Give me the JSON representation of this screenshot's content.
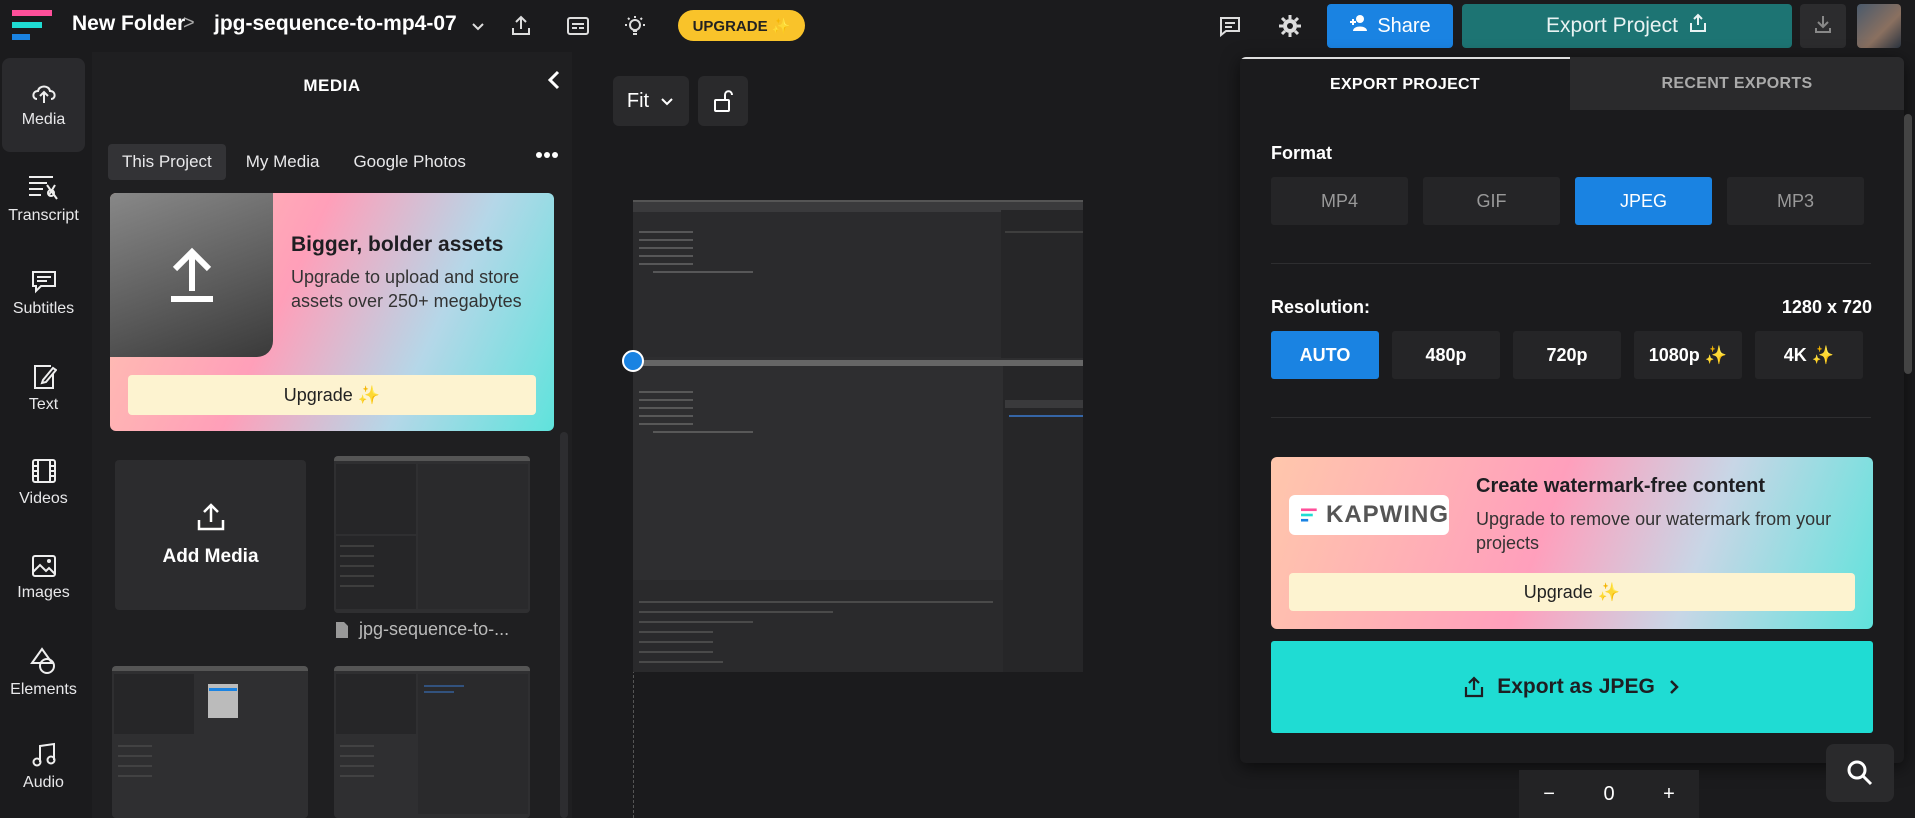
{
  "topbar": {
    "folder": "New Folder",
    "separator": ">",
    "project": "jpg-sequence-to-mp4-07",
    "upgrade_label": "UPGRADE ✨",
    "share_label": "Share",
    "export_label": "Export Project"
  },
  "leftnav": {
    "items": [
      {
        "label": "Media",
        "icon": "upload-cloud-icon"
      },
      {
        "label": "Transcript",
        "icon": "transcript-icon"
      },
      {
        "label": "Subtitles",
        "icon": "subtitles-icon"
      },
      {
        "label": "Text",
        "icon": "text-edit-icon"
      },
      {
        "label": "Videos",
        "icon": "film-icon"
      },
      {
        "label": "Images",
        "icon": "image-icon"
      },
      {
        "label": "Elements",
        "icon": "shapes-icon"
      },
      {
        "label": "Audio",
        "icon": "music-note-icon"
      }
    ]
  },
  "media": {
    "title": "MEDIA",
    "tabs": [
      "This Project",
      "My Media",
      "Google Photos"
    ],
    "promo": {
      "title": "Bigger, bolder assets",
      "body": "Upgrade to upload and store assets over 250+ megabytes",
      "button": "Upgrade ✨"
    },
    "add_media": "Add Media",
    "thumb_label": "jpg-sequence-to-..."
  },
  "canvas": {
    "fit_label": "Fit"
  },
  "export": {
    "tabs": [
      "EXPORT PROJECT",
      "RECENT EXPORTS"
    ],
    "format_label": "Format",
    "formats": [
      "MP4",
      "GIF",
      "JPEG",
      "MP3"
    ],
    "selected_format": "JPEG",
    "resolution_label": "Resolution:",
    "resolution_value": "1280 x 720",
    "resolutions": [
      "AUTO",
      "480p",
      "720p",
      "1080p ✨",
      "4K ✨"
    ],
    "selected_resolution": "AUTO",
    "watermark": {
      "logo_text": "KAPWING",
      "title": "Create watermark-free content",
      "body": "Upgrade to remove our watermark from your projects",
      "button": "Upgrade ✨"
    },
    "export_button": "Export as JPEG"
  },
  "zoom": {
    "minus": "−",
    "value": "0",
    "plus": "+"
  },
  "colors": {
    "accent_blue": "#1a83e2",
    "export_teal": "#1d7473",
    "export_cyan": "#1fdcd3",
    "upgrade_yellow": "#f9c32a"
  }
}
